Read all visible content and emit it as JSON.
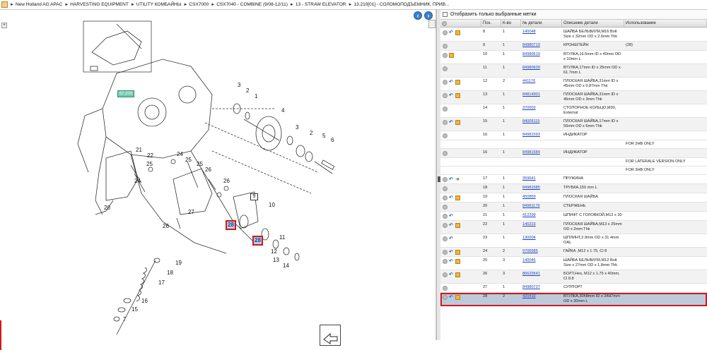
{
  "breadcrumb": [
    "New Holland AG APAC",
    "HARVESTING EQUIPMENT",
    "UTILITY КОМБАЙНЫ",
    "CSX7000",
    "CSX7040 - COMBINE (9/08-12/11)",
    "13 - STRAW ELEVATOR",
    "13.210[01] - СОЛОМОПОДЪЕМНИК, ПРИВ..."
  ],
  "nav": {
    "back_icon": "arrow-left-icon",
    "forward_icon": "arrow-right-icon"
  },
  "drawing": {
    "callouts": {
      "ref_teal": "67.200",
      "highlight_a": "28",
      "highlight_b": "28",
      "box9": "9"
    },
    "labels": [
      "3",
      "2",
      "1",
      "4",
      "3",
      "2",
      "5",
      "6",
      "21",
      "22",
      "24",
      "25",
      "25",
      "26",
      "24",
      "25",
      "26",
      "27",
      "26",
      "20",
      "10",
      "11",
      "12",
      "13",
      "14",
      "19",
      "18",
      "17",
      "16",
      "15",
      "7",
      "28",
      "28",
      "9"
    ]
  },
  "filter": {
    "label": "Отобразить только выбранные метки",
    "checked": false
  },
  "table": {
    "headers": [
      "",
      "Поз.",
      "К-во",
      "№ детали",
      "Описание детали",
      "Использование"
    ],
    "rows": [
      {
        "icons": [
          "grey",
          "blue",
          "box"
        ],
        "pos": "8",
        "qty": "1",
        "pn": "140048",
        "desc": "ШАЙБА БЕЛЬВИЛЯ,M16 Bolt Size x 32mm OD x 2.6mm Thk",
        "use": ""
      },
      {
        "icons": [
          "grey"
        ],
        "pos": "9",
        "qty": "1",
        "pn": "84980710",
        "desc": "КРОНШТЕЙН",
        "use": "(28)"
      },
      {
        "icons": [
          "grey",
          "box"
        ],
        "pos": "10",
        "qty": "1",
        "pn": "84980619",
        "desc": "ВТУЛКА,16.5mm ID x 40mm OD x 10mm L",
        "use": ""
      },
      {
        "icons": [
          "grey"
        ],
        "pos": "11",
        "qty": "1",
        "pn": "84980609",
        "desc": "ВТУЛКА,17mm ID x 25mm OD x 61.7mm L",
        "use": ""
      },
      {
        "icons": [
          "grey",
          "blue",
          "box"
        ],
        "pos": "12",
        "qty": "2",
        "pn": "441176",
        "desc": "ПЛОСКАЯ ШАЙБА,31mm ID x 45mm OD x 0.87mm Thk",
        "use": ""
      },
      {
        "icons": [
          "grey",
          "blue",
          "box"
        ],
        "pos": "13",
        "qty": "1",
        "pn": "84814901",
        "desc": "ПЛОСКАЯ ШАЙБА,31mm ID x 45mm OD x 3mm Thk",
        "use": ""
      },
      {
        "icons": [
          "grey"
        ],
        "pos": "14",
        "qty": "1",
        "pn": "370003",
        "desc": "СТОПОРНОЕ КОЛЬЦО,M30, External",
        "use": ""
      },
      {
        "icons": [
          "grey",
          "blue",
          "box"
        ],
        "pos": "15",
        "qty": "1",
        "pn": "84005115",
        "desc": "ПЛОСКАЯ ШАЙБА,17mm ID x 50mm OD x 6mm Thk",
        "use": ""
      },
      {
        "icons": [
          "grey"
        ],
        "pos": "16",
        "qty": "1",
        "pn": "84981593",
        "desc": "ИНДИКАТОР",
        "use": "",
        "note": "FOR 2HB ONLY"
      },
      {
        "icons": [
          "grey"
        ],
        "pos": "16",
        "qty": "1",
        "pn": "84981584",
        "desc": "ИНДИКАТОР",
        "use": "",
        "note": "FOR LATERALE VERSION ONLY",
        "note2": "FOR 3HB ONLY"
      },
      {
        "icons": [
          "grey",
          "blue",
          "green"
        ],
        "pos": "17",
        "qty": "1",
        "pn": "359641",
        "desc": "ПРУЖИНА",
        "use": ""
      },
      {
        "icons": [
          "grey"
        ],
        "pos": "18",
        "qty": "1",
        "pn": "84981585",
        "desc": "ТРУБКА,150 mm L",
        "use": ""
      },
      {
        "icons": [
          "grey",
          "blue",
          "box"
        ],
        "pos": "19",
        "qty": "1",
        "pn": "450869",
        "desc": "ПЛОСКАЯ ШАЙБА",
        "use": ""
      },
      {
        "icons": [
          "grey"
        ],
        "pos": "20",
        "qty": "1",
        "pn": "84981179",
        "desc": "СТЕРЖЕНЬ",
        "use": ""
      },
      {
        "icons": [
          "grey",
          "blue"
        ],
        "pos": "21",
        "qty": "1",
        "pn": "412299",
        "desc": "ШПИФТ С ГОЛОВКОЙ,M12 x 30",
        "use": ""
      },
      {
        "icons": [
          "grey",
          "blue",
          "box"
        ],
        "pos": "22",
        "qty": "1",
        "pn": "140223",
        "desc": "ПЛОСКАЯ ШАЙБА,M13 x 25mm OD x 2mm Thk",
        "use": ""
      },
      {
        "icons": [
          "grey",
          "blue"
        ],
        "pos": "23",
        "qty": "1",
        "pn": "130004",
        "desc": "ШПЛИНТ,2.9mm OD x 31.4mm OAL",
        "use": ""
      },
      {
        "icons": [
          "grey",
          "blue",
          "box"
        ],
        "pos": "24",
        "qty": "2",
        "pn": "9706685",
        "desc": "ГАЙКА ,M12 x 1.75, Cl 8",
        "use": ""
      },
      {
        "icons": [
          "grey",
          "blue",
          "box"
        ],
        "pos": "25",
        "qty": "3",
        "pn": "140046",
        "desc": "ШАЙБА БЕЛЬВИЛЯ,M12 Bolt Size x 27mm OD x 1.8mm Thk",
        "use": ""
      },
      {
        "icons": [
          "grey",
          "blue",
          "box"
        ],
        "pos": "26",
        "qty": "3",
        "pn": "86629541",
        "desc": "БОЛТ,Hex, M12 x 1.75 x 40mm, Cl 8.8",
        "use": ""
      },
      {
        "icons": [
          "grey"
        ],
        "pos": "27",
        "qty": "1",
        "pn": "84980737",
        "desc": "СУППОРТ",
        "use": ""
      },
      {
        "icons": [
          "grey",
          "blue",
          "box"
        ],
        "pos": "28",
        "qty": "2",
        "pn": "420410",
        "desc": "ВТУЛКА,30h8mm ID x 34H7mm OD x 30mm L",
        "use": "",
        "selected": true
      }
    ]
  }
}
